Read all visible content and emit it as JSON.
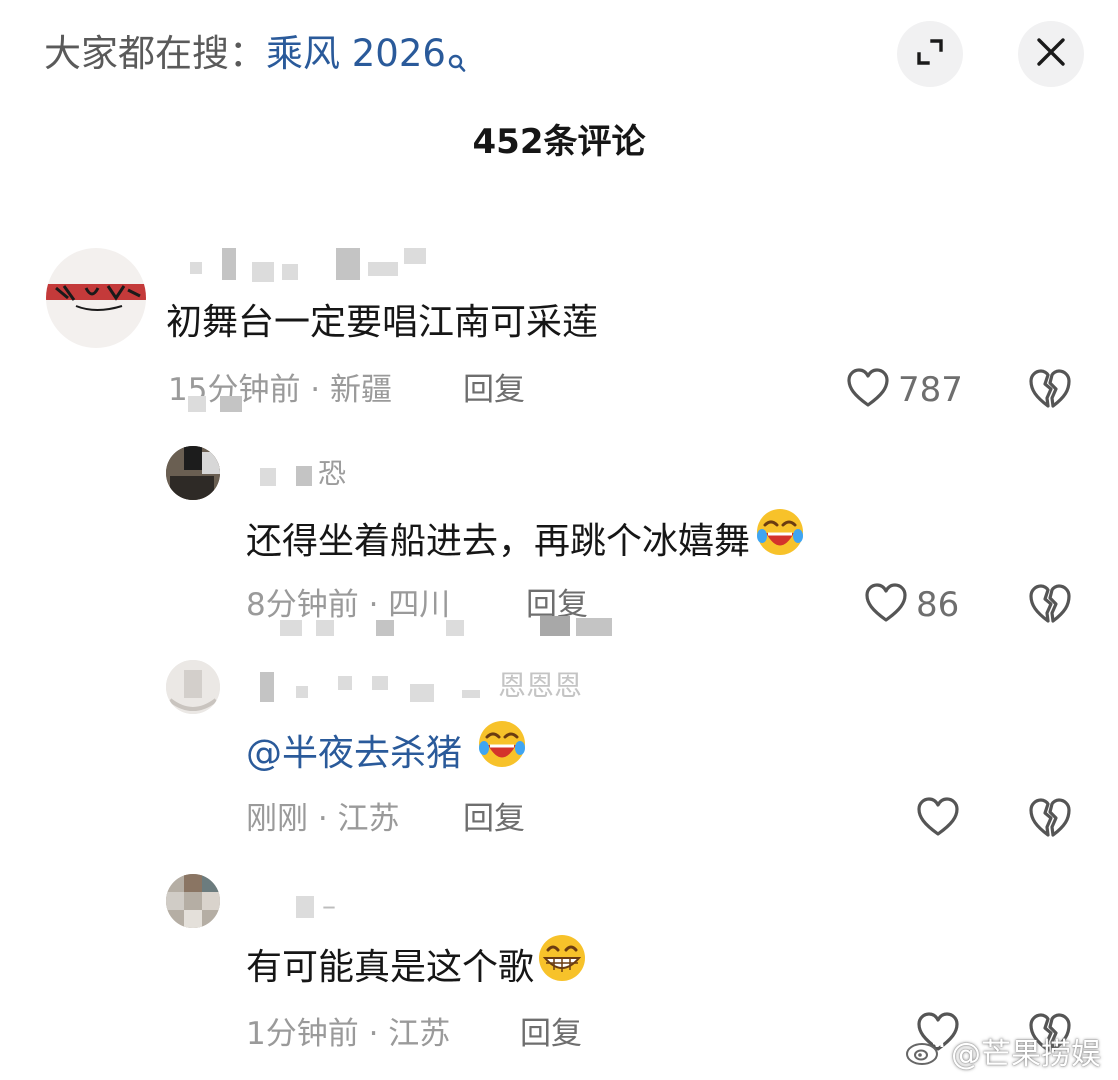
{
  "header": {
    "search_prefix": "大家都在搜：",
    "search_term": "乘风 2026",
    "search_icon": "search-icon",
    "expand_icon": "expand-icon",
    "close_icon": "close-icon"
  },
  "comment_count_label": "452条评论",
  "comments": [
    {
      "avatar_icon": "avatar",
      "text": "初舞台一定要唱江南可采莲",
      "time_location": "15分钟前 · 新疆",
      "reply_label": "回复",
      "likes": "787"
    },
    {
      "avatar_icon": "avatar",
      "username_fragment": "恐",
      "text": "还得坐着船进去，再跳个冰嬉舞",
      "emoji": "rofl-emoji",
      "time_location": "8分钟前 · 四川",
      "reply_label": "回复",
      "likes": "86"
    },
    {
      "avatar_icon": "avatar",
      "username_fragment": "恩恩恩",
      "mention": "@半夜去杀猪",
      "emoji": "rofl-emoji",
      "time_location": "刚刚 · 江苏",
      "reply_label": "回复",
      "likes": ""
    },
    {
      "avatar_icon": "avatar",
      "username_fragment": "–",
      "text": "有可能真是这个歌",
      "emoji": "grin-emoji",
      "time_location": "1分钟前 · 江苏",
      "reply_label": "回复",
      "likes": ""
    }
  ],
  "watermark": {
    "logo_icon": "weibo-icon",
    "text": "@芒果捞娱"
  }
}
